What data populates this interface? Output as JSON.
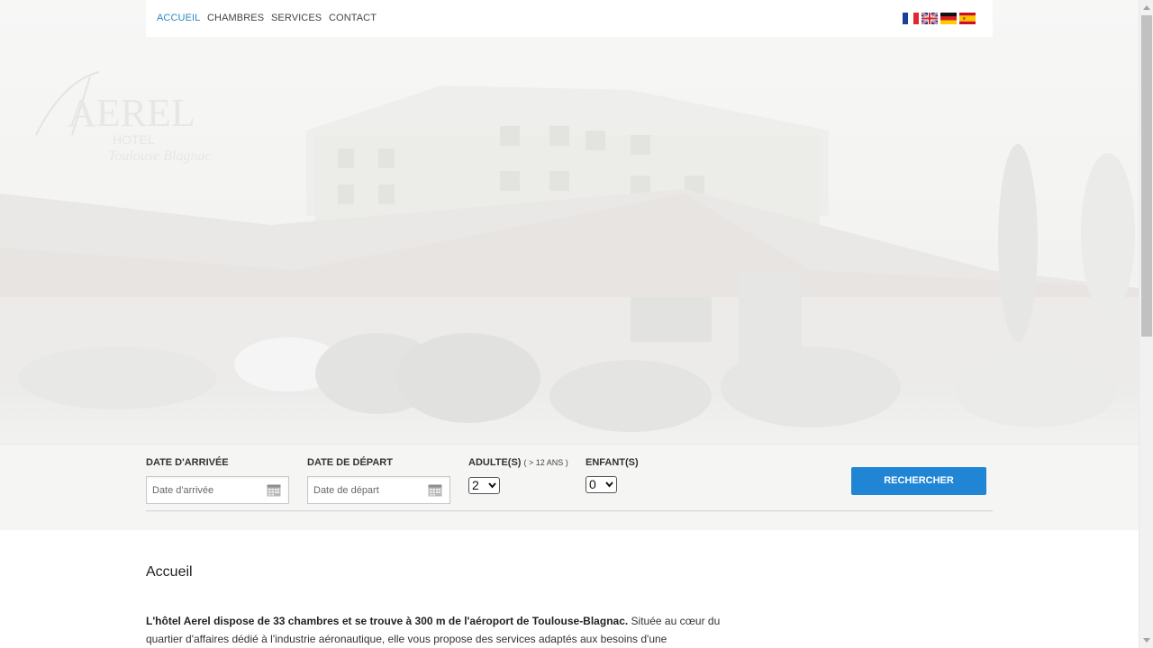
{
  "nav": {
    "items": [
      {
        "label": "ACCUEIL",
        "active": true
      },
      {
        "label": "CHAMBRES",
        "active": false
      },
      {
        "label": "SERVICES",
        "active": false
      },
      {
        "label": "CONTACT",
        "active": false
      }
    ],
    "flags": [
      "french-flag-icon",
      "english-flag-icon",
      "german-flag-icon",
      "spanish-flag-icon"
    ],
    "active_color": "#2b86c6"
  },
  "hero": {
    "logo_text": "AEREL",
    "logo_sub1": "HOTEL",
    "logo_sub2": "Toulouse Blagnac"
  },
  "booking": {
    "arrival_label": "DATE D'ARRIVÉE",
    "arrival_placeholder": "Date d'arrivée",
    "departure_label": "DATE DE DÉPART",
    "departure_placeholder": "Date de départ",
    "adults_label": "ADULTE(S)",
    "adults_sub": "( > 12 ANS )",
    "adults_value": "2",
    "children_label": "ENFANT(S)",
    "children_value": "0",
    "search_label": "RECHERCHER",
    "button_color": "#2185d5"
  },
  "content": {
    "title": "Accueil",
    "intro_bold": "L'hôtel Aerel dispose de 33 chambres et se trouve à 300 m de l'aéroport de Toulouse-Blagnac.",
    "intro_rest": " Située au cœur du quartier d'affaires dédié à l'industrie aéronautique, elle vous propose des services adaptés aux besoins d'une"
  }
}
